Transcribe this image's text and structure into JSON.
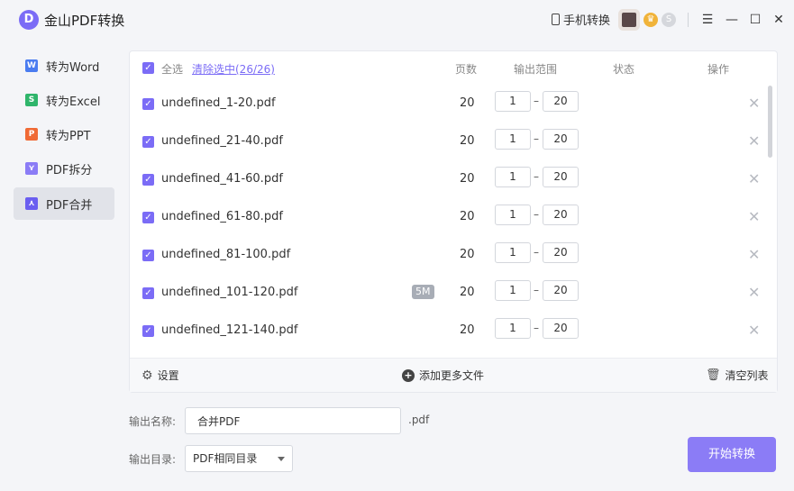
{
  "app": {
    "logo_letter": "D",
    "title": "金山PDF转换",
    "mobile_convert_label": "手机转换",
    "badge_vip": "♛",
    "badge_s": "S",
    "window_controls": {
      "menu": "☰",
      "minimize": "—",
      "maximize": "☐",
      "close": "✕"
    }
  },
  "sidebar": {
    "items": [
      {
        "label": "转为Word",
        "icon": "word-icon",
        "glyph": "W",
        "color": "#4a7cf0"
      },
      {
        "label": "转为Excel",
        "icon": "excel-icon",
        "glyph": "S",
        "color": "#2fb56b"
      },
      {
        "label": "转为PPT",
        "icon": "ppt-icon",
        "glyph": "P",
        "color": "#f06a35"
      },
      {
        "label": "PDF拆分",
        "icon": "split-icon",
        "glyph": "⋎",
        "color": "#8b7cf6"
      },
      {
        "label": "PDF合并",
        "icon": "merge-icon",
        "glyph": "⋏",
        "color": "#6a5ef0"
      }
    ],
    "active_index": 4
  },
  "file_table": {
    "select_all_label": "全选",
    "clear_selection_label": "清除选中(26/26)",
    "columns": {
      "pages": "页数",
      "range": "输出范围",
      "status": "状态",
      "action": "操作"
    },
    "rows": [
      {
        "name": "undefined_1-20.pdf",
        "pages": "20",
        "range_from": "1",
        "range_to": "20",
        "size_badge": ""
      },
      {
        "name": "undefined_21-40.pdf",
        "pages": "20",
        "range_from": "1",
        "range_to": "20",
        "size_badge": ""
      },
      {
        "name": "undefined_41-60.pdf",
        "pages": "20",
        "range_from": "1",
        "range_to": "20",
        "size_badge": ""
      },
      {
        "name": "undefined_61-80.pdf",
        "pages": "20",
        "range_from": "1",
        "range_to": "20",
        "size_badge": ""
      },
      {
        "name": "undefined_81-100.pdf",
        "pages": "20",
        "range_from": "1",
        "range_to": "20",
        "size_badge": ""
      },
      {
        "name": "undefined_101-120.pdf",
        "pages": "20",
        "range_from": "1",
        "range_to": "20",
        "size_badge": "5M"
      },
      {
        "name": "undefined_121-140.pdf",
        "pages": "20",
        "range_from": "1",
        "range_to": "20",
        "size_badge": ""
      }
    ],
    "range_separator": "–",
    "delete_glyph": "✕"
  },
  "footer": {
    "settings_label": "设置",
    "add_files_label": "添加更多文件",
    "clear_list_label": "清空列表"
  },
  "output": {
    "name_label": "输出名称:",
    "name_value": "合并PDF",
    "extension": ".pdf",
    "dir_label": "输出目录:",
    "dir_value": "PDF相同目录",
    "start_button": "开始转换"
  },
  "colors": {
    "accent": "#7b6cf6",
    "start_button": "#8b7cf6"
  }
}
